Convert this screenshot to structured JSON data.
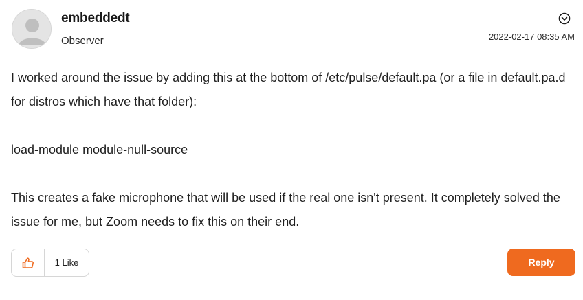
{
  "author": {
    "name": "embeddedt",
    "role": "Observer",
    "avatar_icon": "default-user-avatar-icon"
  },
  "post": {
    "timestamp": "2022-02-17 08:35 AM",
    "paragraphs": [
      "I worked around the issue by adding this at the bottom of /etc/pulse/default.pa (or a file in default.pa.d for distros which have that folder):",
      "load-module module-null-source",
      "This creates a fake microphone that will be used if the real one isn't present. It completely solved the issue for me, but Zoom needs to fix this on their end."
    ]
  },
  "actions": {
    "kudo_icon": "thumbs-up-icon",
    "like_label": "1 Like",
    "reply_label": "Reply",
    "options_icon": "chevron-down-circle-icon"
  },
  "colors": {
    "accent": "#ef6a1f",
    "text": "#1f1f1f",
    "border": "#d6d6d6",
    "avatar_bg": "#e4e4e4"
  }
}
